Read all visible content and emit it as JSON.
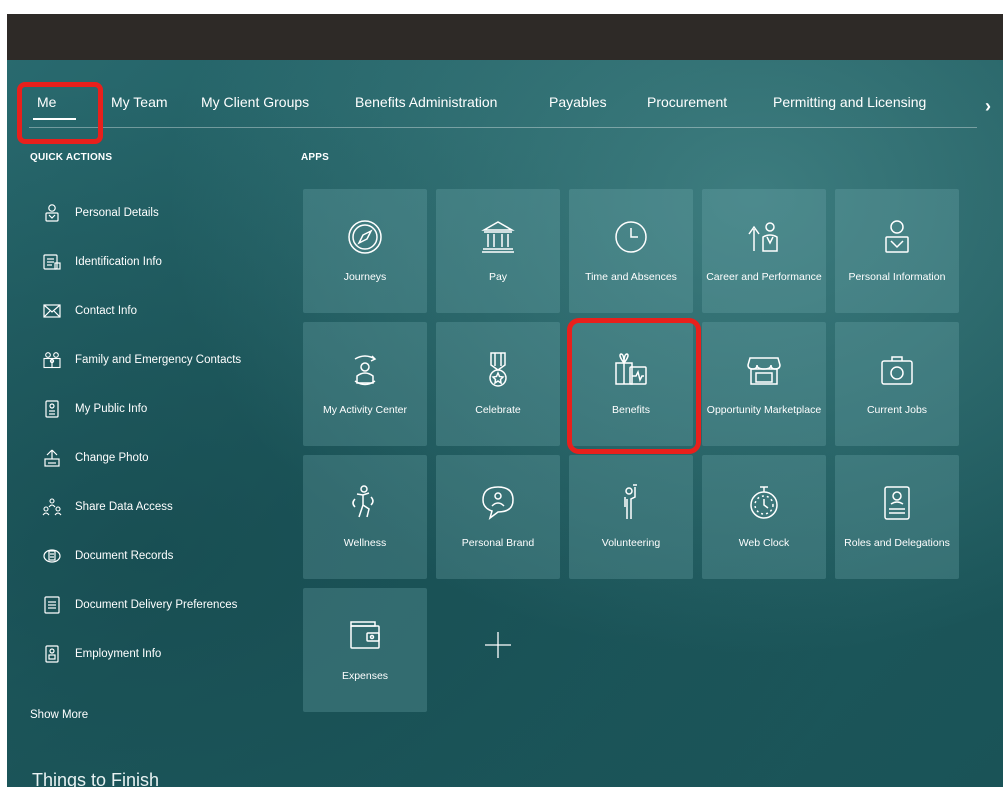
{
  "nav": {
    "tabs": [
      {
        "label": "Me",
        "active": true
      },
      {
        "label": "My Team",
        "active": false
      },
      {
        "label": "My Client Groups",
        "active": false
      },
      {
        "label": "Benefits Administration",
        "active": false
      },
      {
        "label": "Payables",
        "active": false
      },
      {
        "label": "Procurement",
        "active": false
      },
      {
        "label": "Permitting and Licensing",
        "active": false
      }
    ],
    "next_icon": "chevron-right-icon",
    "next_glyph": "›"
  },
  "quick_actions": {
    "heading": "QUICK ACTIONS",
    "items": [
      {
        "label": "Personal Details",
        "icon": "person-icon"
      },
      {
        "label": "Identification Info",
        "icon": "id-card-icon"
      },
      {
        "label": "Contact Info",
        "icon": "envelope-icon"
      },
      {
        "label": "Family and Emergency Contacts",
        "icon": "family-icon"
      },
      {
        "label": "My Public Info",
        "icon": "badge-icon"
      },
      {
        "label": "Change Photo",
        "icon": "upload-photo-icon"
      },
      {
        "label": "Share Data Access",
        "icon": "share-people-icon"
      },
      {
        "label": "Document Records",
        "icon": "document-records-icon"
      },
      {
        "label": "Document Delivery Preferences",
        "icon": "document-icon"
      },
      {
        "label": "Employment Info",
        "icon": "employee-badge-icon"
      }
    ],
    "show_more": "Show More"
  },
  "apps": {
    "heading": "APPS",
    "tiles": [
      {
        "label": "Journeys",
        "icon": "compass-icon"
      },
      {
        "label": "Pay",
        "icon": "bank-icon"
      },
      {
        "label": "Time and Absences",
        "icon": "clock-icon"
      },
      {
        "label": "Career and Performance",
        "icon": "career-icon"
      },
      {
        "label": "Personal Information",
        "icon": "person-card-icon"
      },
      {
        "label": "My Activity Center",
        "icon": "activity-icon"
      },
      {
        "label": "Celebrate",
        "icon": "medal-icon"
      },
      {
        "label": "Benefits",
        "icon": "gift-health-icon"
      },
      {
        "label": "Opportunity Marketplace",
        "icon": "storefront-icon"
      },
      {
        "label": "Current Jobs",
        "icon": "briefcase-icon"
      },
      {
        "label": "Wellness",
        "icon": "wellness-icon"
      },
      {
        "label": "Personal Brand",
        "icon": "speech-person-icon"
      },
      {
        "label": "Volunteering",
        "icon": "volunteer-icon"
      },
      {
        "label": "Web Clock",
        "icon": "stopwatch-icon"
      },
      {
        "label": "Roles and Delegations",
        "icon": "roles-badge-icon"
      },
      {
        "label": "Expenses",
        "icon": "wallet-icon"
      }
    ],
    "add_icon": "plus-icon"
  },
  "things_to_finish": "Things to Finish",
  "colors": {
    "highlight": "#e8201c",
    "topbar": "#2e2a27",
    "background": "#1f5d61"
  }
}
